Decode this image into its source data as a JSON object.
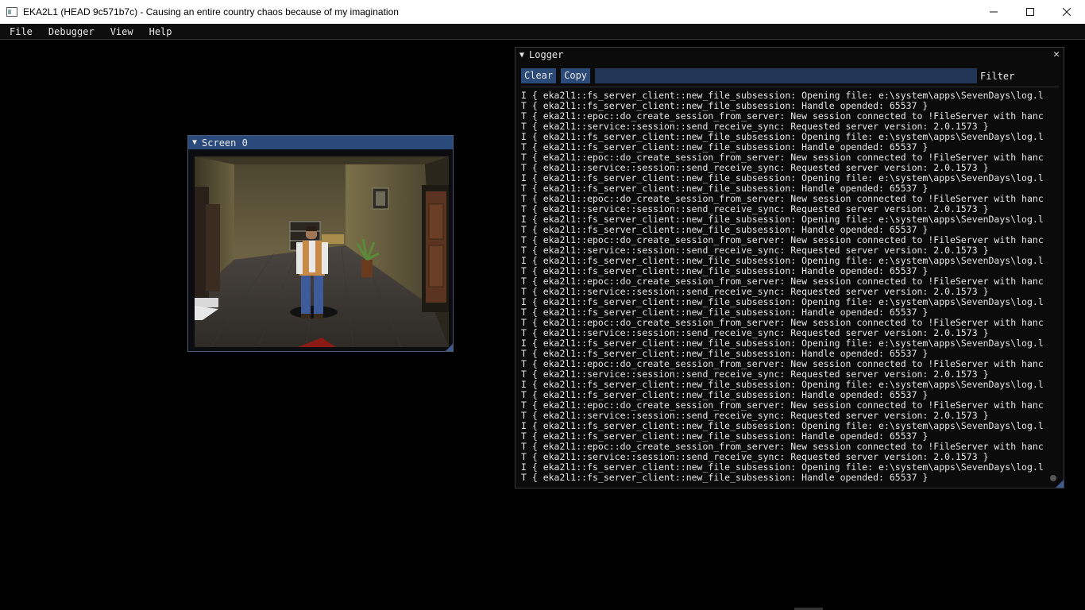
{
  "window": {
    "title": "EKA2L1 (HEAD 9c571b7c) - Causing an entire country chaos because of my imagination",
    "minimize_glyph": "—",
    "maximize_glyph": "☐",
    "close_glyph": "✕"
  },
  "menu": {
    "items": [
      "File",
      "Debugger",
      "View",
      "Help"
    ]
  },
  "screen_window": {
    "title": "Screen 0",
    "collapse_glyph": "▼"
  },
  "logger": {
    "title": "Logger",
    "collapse_glyph": "▼",
    "close_glyph": "✕",
    "clear_label": "Clear",
    "copy_label": "Copy",
    "filter_value": "",
    "filter_label": "Filter",
    "lines": [
      "I { eka2l1::fs_server_client::new_file_subsession: Opening file: e:\\system\\apps\\SevenDays\\log.l",
      "T { eka2l1::fs_server_client::new_file_subsession: Handle opended: 65537 }",
      "T { eka2l1::epoc::do_create_session_from_server: New session connected to !FileServer with hanc",
      "T { eka2l1::service::session::send_receive_sync: Requested server version: 2.0.1573 }",
      "I { eka2l1::fs_server_client::new_file_subsession: Opening file: e:\\system\\apps\\SevenDays\\log.l",
      "T { eka2l1::fs_server_client::new_file_subsession: Handle opended: 65537 }",
      "T { eka2l1::epoc::do_create_session_from_server: New session connected to !FileServer with hanc",
      "T { eka2l1::service::session::send_receive_sync: Requested server version: 2.0.1573 }",
      "I { eka2l1::fs_server_client::new_file_subsession: Opening file: e:\\system\\apps\\SevenDays\\log.l",
      "T { eka2l1::fs_server_client::new_file_subsession: Handle opended: 65537 }",
      "T { eka2l1::epoc::do_create_session_from_server: New session connected to !FileServer with hanc",
      "T { eka2l1::service::session::send_receive_sync: Requested server version: 2.0.1573 }",
      "I { eka2l1::fs_server_client::new_file_subsession: Opening file: e:\\system\\apps\\SevenDays\\log.l",
      "T { eka2l1::fs_server_client::new_file_subsession: Handle opended: 65537 }",
      "T { eka2l1::epoc::do_create_session_from_server: New session connected to !FileServer with hanc",
      "T { eka2l1::service::session::send_receive_sync: Requested server version: 2.0.1573 }",
      "I { eka2l1::fs_server_client::new_file_subsession: Opening file: e:\\system\\apps\\SevenDays\\log.l",
      "T { eka2l1::fs_server_client::new_file_subsession: Handle opended: 65537 }",
      "T { eka2l1::epoc::do_create_session_from_server: New session connected to !FileServer with hanc",
      "T { eka2l1::service::session::send_receive_sync: Requested server version: 2.0.1573 }",
      "I { eka2l1::fs_server_client::new_file_subsession: Opening file: e:\\system\\apps\\SevenDays\\log.l",
      "T { eka2l1::fs_server_client::new_file_subsession: Handle opended: 65537 }",
      "T { eka2l1::epoc::do_create_session_from_server: New session connected to !FileServer with hanc",
      "T { eka2l1::service::session::send_receive_sync: Requested server version: 2.0.1573 }",
      "I { eka2l1::fs_server_client::new_file_subsession: Opening file: e:\\system\\apps\\SevenDays\\log.l",
      "T { eka2l1::fs_server_client::new_file_subsession: Handle opended: 65537 }",
      "T { eka2l1::epoc::do_create_session_from_server: New session connected to !FileServer with hanc",
      "T { eka2l1::service::session::send_receive_sync: Requested server version: 2.0.1573 }",
      "I { eka2l1::fs_server_client::new_file_subsession: Opening file: e:\\system\\apps\\SevenDays\\log.l",
      "T { eka2l1::fs_server_client::new_file_subsession: Handle opended: 65537 }",
      "T { eka2l1::epoc::do_create_session_from_server: New session connected to !FileServer with hanc",
      "T { eka2l1::service::session::send_receive_sync: Requested server version: 2.0.1573 }",
      "I { eka2l1::fs_server_client::new_file_subsession: Opening file: e:\\system\\apps\\SevenDays\\log.l",
      "T { eka2l1::fs_server_client::new_file_subsession: Handle opended: 65537 }",
      "T { eka2l1::epoc::do_create_session_from_server: New session connected to !FileServer with hanc",
      "T { eka2l1::service::session::send_receive_sync: Requested server version: 2.0.1573 }",
      "I { eka2l1::fs_server_client::new_file_subsession: Opening file: e:\\system\\apps\\SevenDays\\log.l",
      "T { eka2l1::fs_server_client::new_file_subsession: Handle opended: 65537 }"
    ]
  },
  "colors": {
    "imgui_title_active": "#294a7a",
    "imgui_button": "#2b4a78",
    "imgui_frame": "#233556",
    "background": "#000000",
    "text": "#e6e6e6"
  }
}
